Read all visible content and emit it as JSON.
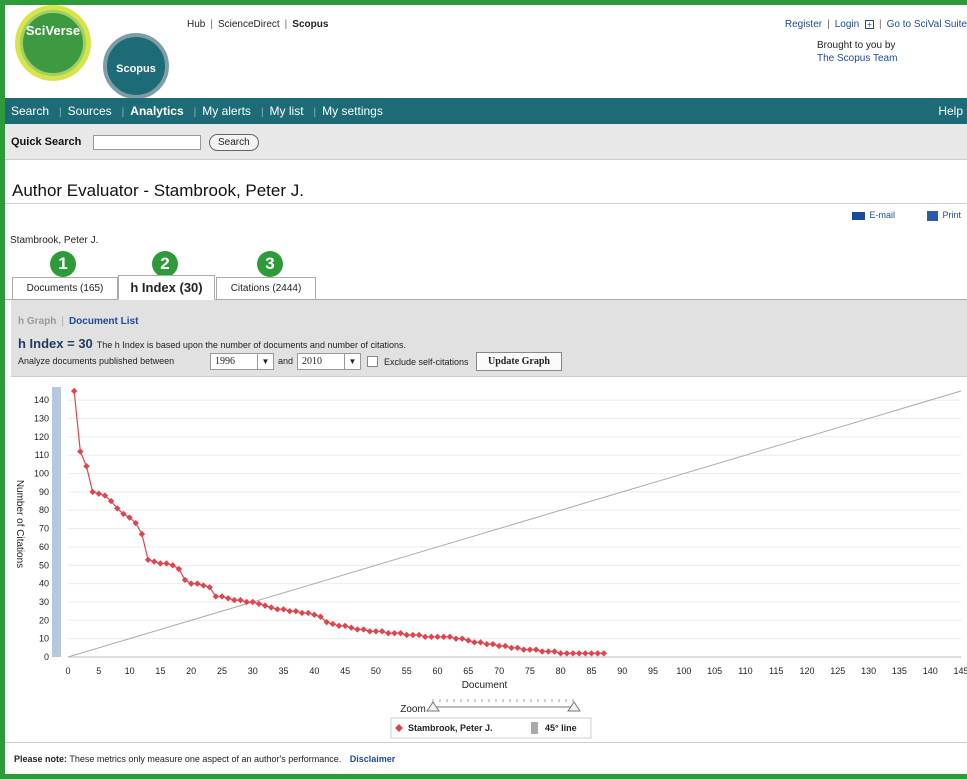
{
  "header": {
    "logo_top": "SciVerse",
    "logo_bottom": "Scopus",
    "links": [
      "Hub",
      "ScienceDirect",
      "Scopus"
    ],
    "register": "Register",
    "login": "Login",
    "login_icon": "plus-box-icon",
    "scival": "Go to SciVal Suite",
    "brought_by": "Brought to you by",
    "team": "The Scopus Team"
  },
  "nav": {
    "items": [
      "Search",
      "Sources",
      "Analytics",
      "My alerts",
      "My list",
      "My settings"
    ],
    "active": "Analytics",
    "help": "Help"
  },
  "quick_search": {
    "label": "Quick Search",
    "value": "",
    "button": "Search"
  },
  "page": {
    "title": "Author Evaluator - Stambrook, Peter J.",
    "email": "E-mail",
    "print": "Print",
    "author": "Stambrook, Peter J."
  },
  "tabs": [
    {
      "badge": "1",
      "label": "Documents (165)"
    },
    {
      "badge": "2",
      "label": "h Index (30)"
    },
    {
      "badge": "3",
      "label": "Citations (2444)"
    }
  ],
  "panel": {
    "sub_graph": "h Graph",
    "sub_list": "Document List",
    "h_index": "h Index = 30",
    "h_desc": "The h Index is based upon the number of documents and number of citations.",
    "analyze": "Analyze documents published between",
    "from_year": "1996",
    "and": "and",
    "to_year": "2010",
    "exclude": "Exclude self-citations",
    "update": "Update Graph"
  },
  "chart_data": {
    "type": "scatter",
    "xlabel": "Document",
    "ylabel": "Number of Citations",
    "xlim": [
      0,
      145
    ],
    "ylim": [
      0,
      145
    ],
    "x_ticks": [
      0,
      5,
      10,
      15,
      20,
      25,
      30,
      35,
      40,
      45,
      50,
      55,
      60,
      65,
      70,
      75,
      80,
      85,
      90,
      95,
      100,
      105,
      110,
      115,
      120,
      125,
      130,
      135,
      140,
      145
    ],
    "y_ticks": [
      0,
      10,
      20,
      30,
      40,
      50,
      60,
      70,
      80,
      90,
      100,
      110,
      120,
      130,
      140
    ],
    "series": [
      {
        "name": "Stambrook, Peter J.",
        "color": "#e0444e",
        "x": [
          1,
          2,
          3,
          4,
          5,
          6,
          7,
          8,
          9,
          10,
          11,
          12,
          13,
          14,
          15,
          16,
          17,
          18,
          19,
          20,
          21,
          22,
          23,
          24,
          25,
          26,
          27,
          28,
          29,
          30,
          31,
          32,
          33,
          34,
          35,
          36,
          37,
          38,
          39,
          40,
          41,
          42,
          43,
          44,
          45,
          46,
          47,
          48,
          49,
          50,
          51,
          52,
          53,
          54,
          55,
          56,
          57,
          58,
          59,
          60,
          61,
          62,
          63,
          64,
          65,
          66,
          67,
          68,
          69,
          70,
          71,
          72,
          73,
          74,
          75,
          76,
          77,
          78,
          79,
          80,
          81,
          82,
          83,
          84,
          85,
          86,
          87
        ],
        "y": [
          145,
          112,
          104,
          90,
          89,
          88,
          85,
          81,
          78,
          76,
          73,
          67,
          53,
          52,
          51,
          51,
          50,
          48,
          42,
          40,
          40,
          39,
          38,
          33,
          33,
          32,
          31,
          31,
          30,
          30,
          29,
          28,
          27,
          26,
          26,
          25,
          25,
          24,
          24,
          23,
          22,
          19,
          18,
          17,
          17,
          16,
          15,
          15,
          14,
          14,
          14,
          13,
          13,
          13,
          12,
          12,
          12,
          11,
          11,
          11,
          11,
          11,
          10,
          10,
          9,
          8,
          8,
          7,
          7,
          6,
          6,
          5,
          5,
          4,
          4,
          4,
          3,
          3,
          3,
          2,
          2,
          2,
          2,
          2,
          2,
          2,
          2
        ]
      },
      {
        "name": "45° line",
        "color": "#aaaaaa"
      }
    ],
    "zoom_label": "Zoom",
    "legend_position": "bottom-center"
  },
  "footer": {
    "note_label": "Please note:",
    "note_text": "These metrics only measure one aspect of an author's performance.",
    "disclaimer": "Disclaimer"
  }
}
